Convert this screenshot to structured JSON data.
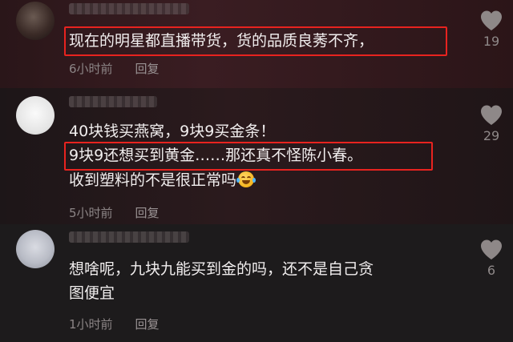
{
  "comments": [
    {
      "lines": [
        "现在的明星都直播带货，货的品质良莠不齐，"
      ],
      "time": "6小时前",
      "reply": "回复",
      "likes": "19"
    },
    {
      "lines": [
        "40块钱买燕窝，9块9买金条！",
        "9块9还想买到黄金……那还真不怪陈小春。",
        "收到塑料的不是很正常吗"
      ],
      "time": "5小时前",
      "reply": "回复",
      "likes": "29",
      "emoji": "laugh-cry-emoji"
    },
    {
      "lines": [
        "想啥呢，九块九能买到金的吗，还不是自己贪",
        "图便宜"
      ],
      "time": "1小时前",
      "reply": "回复",
      "likes": "6"
    }
  ],
  "colors": {
    "highlight": "#e8231f",
    "heart": "#8e8888",
    "meta": "#8c8586"
  }
}
